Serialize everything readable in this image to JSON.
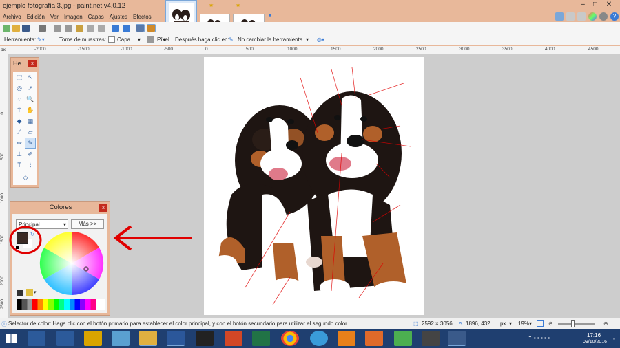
{
  "window": {
    "title": "ejemplo fotografía 3.jpg - paint.net v4.0.12"
  },
  "menu": [
    "Archivo",
    "Edición",
    "Ver",
    "Imagen",
    "Capas",
    "Ajustes",
    "Efectos"
  ],
  "toolbar2": {
    "tool_label": "Herramienta:",
    "sampling_label": "Toma de muestras:",
    "layer_option": "Capa",
    "pixel_option": "Píxel",
    "after_click_label": "Después haga clic en:",
    "after_click_value": "No cambiar la herramienta"
  },
  "ruler": {
    "unit": "px",
    "h_ticks": [
      "-2000",
      "-1500",
      "-1000",
      "-500",
      "0",
      "500",
      "1000",
      "1500",
      "2000",
      "2500",
      "3000",
      "3500",
      "4000",
      "4500"
    ],
    "v_ticks": [
      "0",
      "500",
      "1000",
      "1500",
      "2000",
      "2500"
    ]
  },
  "tools_panel": {
    "title": "He...",
    "close": "x"
  },
  "colors_panel": {
    "title": "Colores",
    "close": "x",
    "dropdown": "Principal",
    "more_button": "Más >>",
    "primary_color": "#3a2a24",
    "secondary_color": "#ffffff"
  },
  "status": {
    "message": "Selector de color: Haga clic con el botón primario para establecer el color principal, y con el botón secundario para utilizar el segundo color.",
    "image_size": "2592 × 3056",
    "cursor_pos": "1896, 432",
    "units": "px",
    "zoom": "19%"
  },
  "taskbar": {
    "time": "17:16",
    "date": "09/10/2016"
  },
  "colors": {
    "accent": "#e8b89a",
    "annotation_red": "#e00000",
    "taskbar": "#1f3f70"
  }
}
